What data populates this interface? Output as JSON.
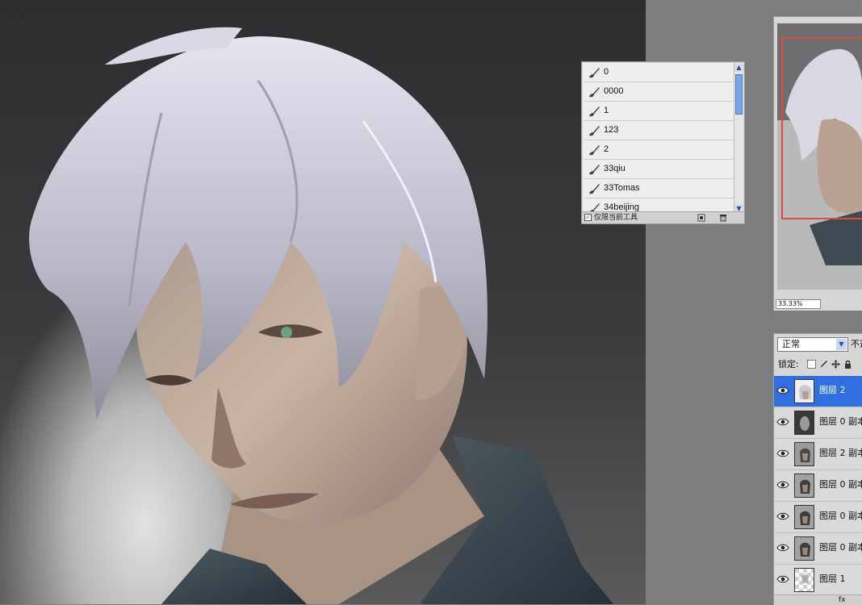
{
  "tool_presets": {
    "items": [
      "0",
      "0000",
      "1",
      "123",
      "2",
      "33qiu",
      "33Tomas",
      "34beijing"
    ],
    "current_tool_only_label": "仅限当前工具",
    "current_tool_only_checked": true,
    "scroll_up": "▲",
    "scroll_down": "▼"
  },
  "navigator": {
    "zoom": "33.33%"
  },
  "layers": {
    "blend_mode": "正常",
    "opacity_label": "不透",
    "lock_label": "锁定:",
    "rows": [
      {
        "name": "图层 2",
        "selected": true
      },
      {
        "name": "图层 0 副本",
        "selected": false
      },
      {
        "name": "图层 2 副本",
        "selected": false
      },
      {
        "name": "图层 0 副本",
        "selected": false
      },
      {
        "name": "图层 0 副本",
        "selected": false
      },
      {
        "name": "图层 0 副本",
        "selected": false
      },
      {
        "name": "图层 1",
        "selected": false
      }
    ],
    "footer_fx": "fx"
  },
  "colors": {
    "accent_selection": "#2f6fe0",
    "navigator_view_box": "#e04a3a",
    "scroll_thumb": "#7aa5e6"
  }
}
